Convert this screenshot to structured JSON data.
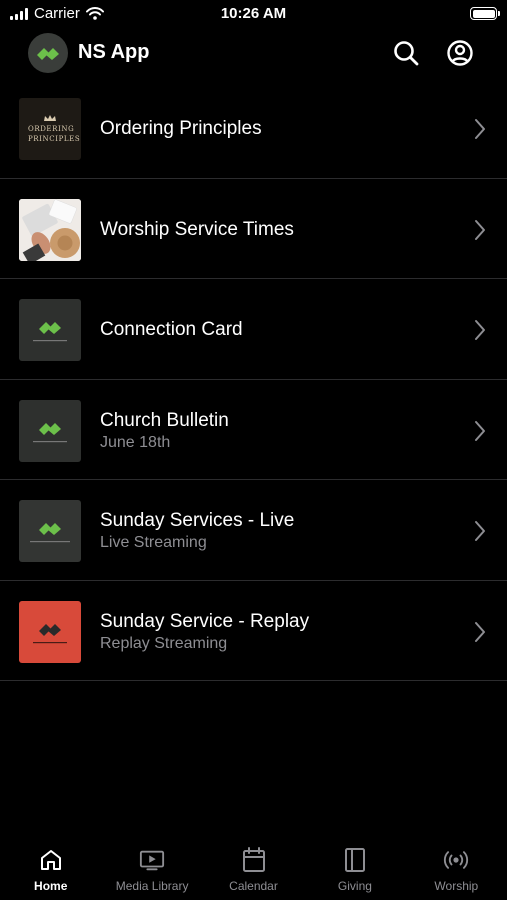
{
  "status_bar": {
    "carrier": "Carrier",
    "time": "10:26 AM"
  },
  "header": {
    "title": "NS App",
    "logo_icon": "ns-logo-icon",
    "search_icon": "search-icon",
    "profile_icon": "profile-icon"
  },
  "colors": {
    "background": "#000000",
    "text": "#ffffff",
    "subtitle": "#8e8e93",
    "divider": "#2c2c2e",
    "brand_green": "#6cc04a",
    "replay_red": "#d84a3a"
  },
  "items": [
    {
      "title": "Ordering Principles",
      "subtitle": "",
      "thumb_text": "ORDERING PRINCIPLES",
      "thumb": "ordering-principles-thumbnail"
    },
    {
      "title": "Worship Service Times",
      "subtitle": "",
      "thumb": "worship-photo-thumbnail"
    },
    {
      "title": "Connection Card",
      "subtitle": "",
      "thumb": "ns-logo-thumbnail"
    },
    {
      "title": "Church Bulletin",
      "subtitle": "June 18th",
      "thumb": "ns-logo-thumbnail"
    },
    {
      "title": "Sunday Services - Live",
      "subtitle": "Live Streaming",
      "thumb": "ns-logo-thumbnail"
    },
    {
      "title": "Sunday Service - Replay",
      "subtitle": "Replay Streaming",
      "thumb": "ns-logo-red-thumbnail"
    }
  ],
  "tabs": [
    {
      "label": "Home",
      "icon": "home-icon",
      "active": true
    },
    {
      "label": "Media Library",
      "icon": "media-library-icon",
      "active": false
    },
    {
      "label": "Calendar",
      "icon": "calendar-icon",
      "active": false
    },
    {
      "label": "Giving",
      "icon": "giving-icon",
      "active": false
    },
    {
      "label": "Worship",
      "icon": "broadcast-icon",
      "active": false
    }
  ]
}
